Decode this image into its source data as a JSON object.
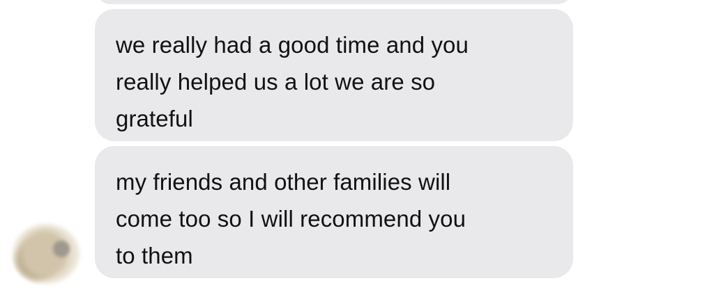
{
  "conversation": {
    "messages": [
      {
        "lines": [
          "we really had a good time and you",
          "really helped us a lot we are so",
          "grateful"
        ]
      },
      {
        "lines": [
          "my friends and other families will",
          "come too so I will recommend you",
          "to them"
        ]
      }
    ]
  },
  "colors": {
    "bubble_background": "#e9e9eb",
    "text": "#111111",
    "background": "#ffffff"
  },
  "icons": {
    "sender_avatar": "blurred-profile-picture"
  }
}
